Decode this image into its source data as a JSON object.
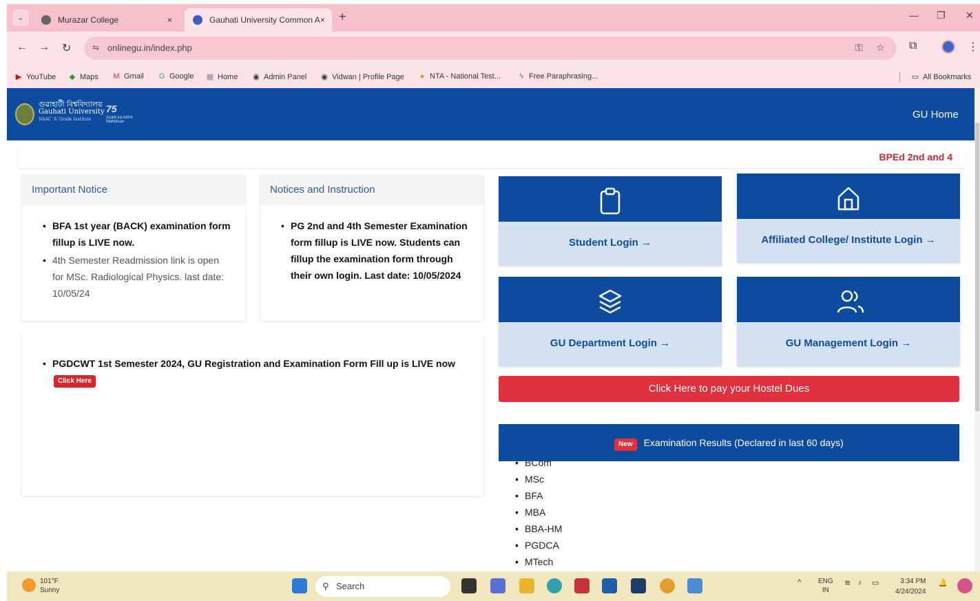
{
  "browser": {
    "tabs": [
      {
        "title": "Murazar College",
        "close": "×"
      },
      {
        "title": "Gauhati University Common A",
        "close": "×"
      }
    ],
    "new_tab": "+",
    "url": "onlinegu.in/index.php",
    "bookmarks": [
      {
        "label": "YouTube",
        "icon": "youtube-icon"
      },
      {
        "label": "Maps",
        "icon": "maps-icon"
      },
      {
        "label": "Gmail",
        "icon": "gmail-icon"
      },
      {
        "label": "Google",
        "icon": "google-icon"
      },
      {
        "label": "Home",
        "icon": "home-bookmark-icon"
      },
      {
        "label": "Admin Panel",
        "icon": "globe-icon"
      },
      {
        "label": "Vidwan | Profile Page",
        "icon": "globe-icon"
      },
      {
        "label": "NTA - National Test...",
        "icon": "nta-icon"
      },
      {
        "label": "Free Paraphrasing...",
        "icon": "paraphrase-icon"
      }
    ],
    "all_bookmarks": "All Bookmarks"
  },
  "header": {
    "logo_line1": "গুৱাহাটী বিশ্ববিদ্যালয়",
    "logo_line2": "Gauhati University",
    "logo_line3": "NAAC 'A' Grade Institute",
    "logo_75": "75",
    "logo_75_sub": "Azadi ka Amrit Mahotsav",
    "home_link": "GU Home"
  },
  "marquee": "BPEd 2nd and 4",
  "important_notice": {
    "title": "Important Notice",
    "items": [
      "BFA 1st year (BACK) examination form fillup is LIVE now.",
      "4th Semester Readmission link is open for MSc. Radiological Physics. last date: 10/05/24"
    ]
  },
  "notices_instruction": {
    "title": "Notices and Instruction",
    "items": [
      "PG 2nd and 4th Semester Examination form fillup is LIVE now. Students can fillup the examination form through their own login. Last date: 10/05/2024"
    ]
  },
  "pgdcwt_notice": {
    "text": "PGDCWT 1st Semester 2024, GU Registration and Examination Form Fill up is LIVE now",
    "click_here": "Click Here"
  },
  "logins": [
    {
      "label": "Student Login →",
      "icon": "clipboard-icon"
    },
    {
      "label": "Affiliated College/ Institute Login →",
      "icon": "home-icon"
    },
    {
      "label": "GU Department Login →",
      "icon": "layers-icon"
    },
    {
      "label": "GU Management Login →",
      "icon": "users-icon"
    }
  ],
  "hostel_button": "Click Here to pay your Hostel Dues",
  "results": {
    "badge": "New",
    "title": "Examination Results (Declared in last 60 days)",
    "items": [
      "BCom",
      "MSc",
      "BFA",
      "MBA",
      "BBA-HM",
      "PGDCA",
      "MTech"
    ]
  },
  "taskbar": {
    "temp": "101°F",
    "weather": "Sunny",
    "search": "Search",
    "lang1": "ENG",
    "lang2": "IN",
    "time": "3:34 PM",
    "date": "4/24/2024"
  },
  "colors": {
    "brand_blue": "#0d4b9e",
    "accent_red": "#e0313e",
    "browser_pink": "#f6c1cb"
  }
}
